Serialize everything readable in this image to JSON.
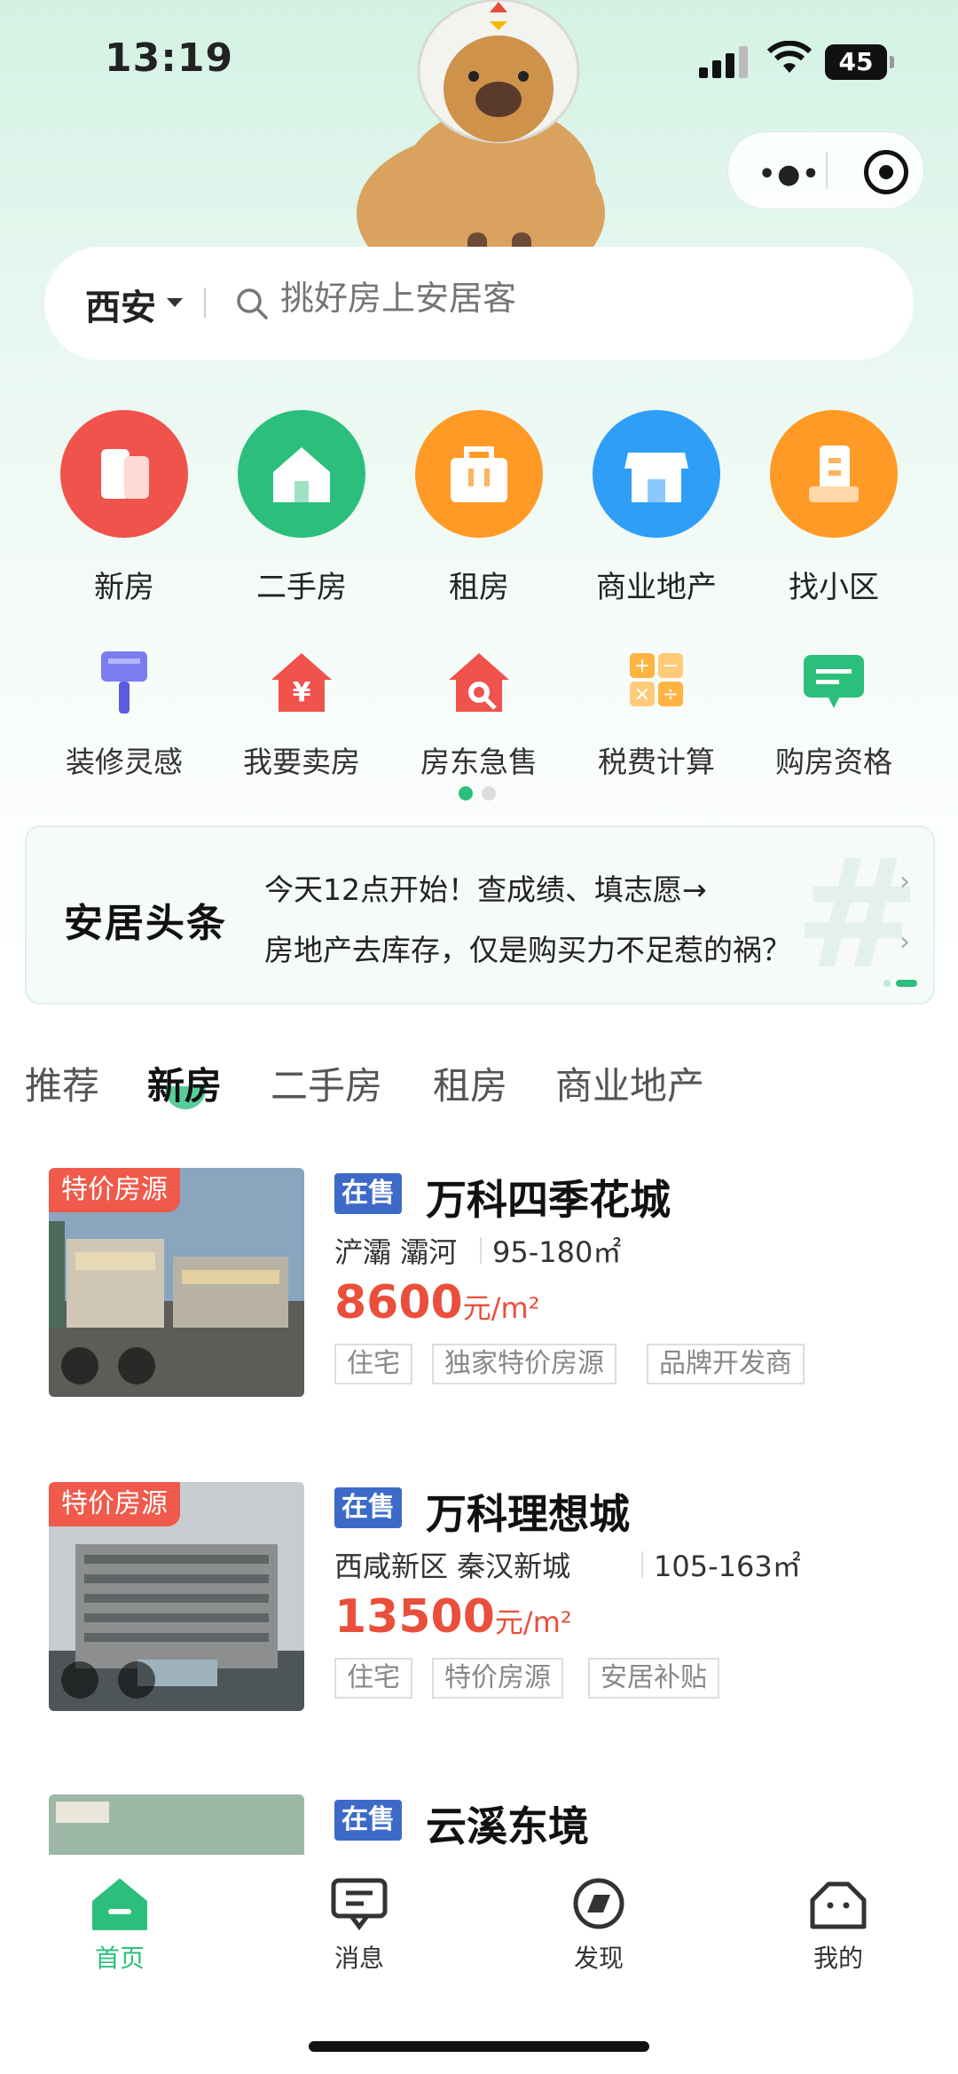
{
  "status_bar": {
    "time": "13:19",
    "battery": "45"
  },
  "search": {
    "city": "西安",
    "placeholder": "挑好房上安居客"
  },
  "main_nav": [
    {
      "label": "新房",
      "color": "#f0524c",
      "icon": "new-house-icon"
    },
    {
      "label": "二手房",
      "color": "#2cbf7c",
      "icon": "second-hand-house-icon"
    },
    {
      "label": "租房",
      "color": "#ff9a26",
      "icon": "rent-bag-icon"
    },
    {
      "label": "商业地产",
      "color": "#2f9ef6",
      "icon": "shop-icon"
    },
    {
      "label": "找小区",
      "color": "#ff9a26",
      "icon": "community-building-icon"
    }
  ],
  "sub_nav": [
    {
      "label": "装修灵感",
      "icon": "paint-brush-icon"
    },
    {
      "label": "我要卖房",
      "icon": "sell-house-icon"
    },
    {
      "label": "房东急售",
      "icon": "urgent-sale-icon"
    },
    {
      "label": "税费计算",
      "icon": "calculator-icon"
    },
    {
      "label": "购房资格",
      "icon": "qualification-chat-icon"
    }
  ],
  "headline": {
    "logo": "安居头条",
    "lines": [
      "今天12点开始！查成绩、填志愿→",
      "房地产去库存，仅是购买力不足惹的祸？"
    ]
  },
  "tabs": [
    "推荐",
    "新房",
    "二手房",
    "租房",
    "商业地产"
  ],
  "active_tab": "新房",
  "listings": [
    {
      "promo": "特价房源",
      "status": "在售",
      "name": "万科四季花城",
      "location": "浐灞 灞河",
      "area": "95-180㎡",
      "price": "8600",
      "unit": "元/m²",
      "tags": [
        "住宅",
        "独家特价房源",
        "品牌开发商"
      ]
    },
    {
      "promo": "特价房源",
      "status": "在售",
      "name": "万科理想城",
      "location": "西咸新区 秦汉新城",
      "area": "105-163㎡",
      "price": "13500",
      "unit": "元/m²",
      "tags": [
        "住宅",
        "特价房源",
        "安居补贴"
      ]
    },
    {
      "status": "在售",
      "name": "云溪东境"
    }
  ],
  "bottom_tabs": [
    {
      "label": "首页",
      "icon": "home-icon",
      "active": true
    },
    {
      "label": "消息",
      "icon": "message-icon",
      "active": false
    },
    {
      "label": "发现",
      "icon": "discover-icon",
      "active": false
    },
    {
      "label": "我的",
      "icon": "profile-icon",
      "active": false
    }
  ],
  "colors": {
    "accent": "#2cbf7c",
    "price": "#e94f3b",
    "status_badge": "#3d6ac9",
    "promo": "#ef5a4b"
  }
}
